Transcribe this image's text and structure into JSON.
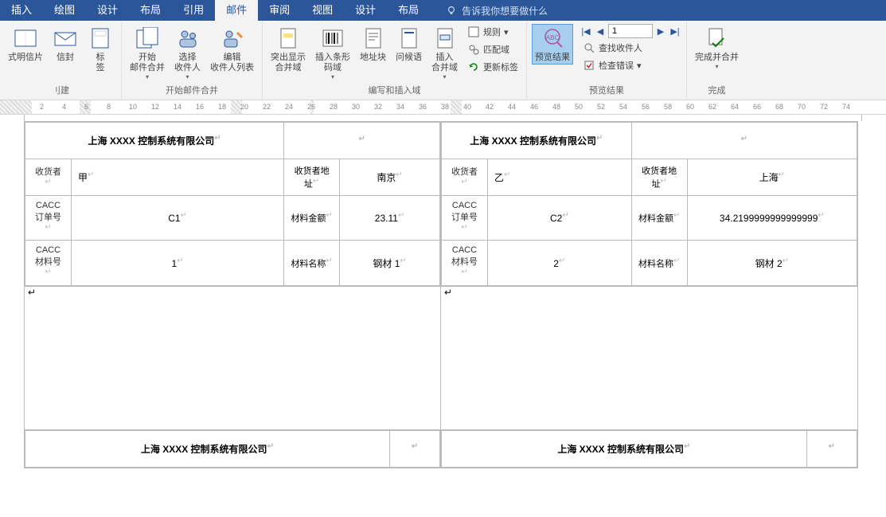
{
  "menubar": {
    "tabs": [
      "插入",
      "绘图",
      "设计",
      "布局",
      "引用",
      "邮件",
      "审阅",
      "视图",
      "设计",
      "布局"
    ],
    "active_index": 5,
    "tell_me_placeholder": "告诉我你想要做什么"
  },
  "ribbon": {
    "group_create": {
      "label": "刂建",
      "buttons": {
        "postcard": "式明信片",
        "envelope": "信封",
        "label": "标\n签"
      }
    },
    "group_start": {
      "label": "开始邮件合并",
      "buttons": {
        "start_merge": "开始\n邮件合并",
        "select_recip": "选择\n收件人",
        "edit_recip": "编辑\n收件人列表"
      }
    },
    "group_write": {
      "label": "编写和插入域",
      "buttons": {
        "highlight": "突出显示\n合并域",
        "barcode": "插入条形\n码域",
        "address": "地址块",
        "greeting": "问候语",
        "merge_field": "插入\n合并域"
      },
      "small": {
        "rules": "规则",
        "match": "匹配域",
        "update": "更新标签"
      }
    },
    "group_preview": {
      "label": "预览结果",
      "buttons": {
        "preview": "预览结果"
      },
      "nav_value": "1",
      "small": {
        "find": "查找收件人",
        "check": "检查错误"
      }
    },
    "group_finish": {
      "label": "完成",
      "buttons": {
        "finish": "完成并合并"
      }
    }
  },
  "ruler": {
    "ticks": [
      2,
      4,
      6,
      8,
      10,
      12,
      14,
      16,
      18,
      20,
      22,
      24,
      26,
      28,
      30,
      32,
      34,
      36,
      38,
      40,
      42,
      44,
      46,
      48,
      50,
      52,
      54,
      56,
      58,
      60,
      62,
      64,
      66,
      68,
      70,
      72,
      74
    ]
  },
  "document": {
    "title": "上海 XXXX 控制系统有限公司",
    "labels_row1": [
      {
        "recv_lbl": "收货者",
        "recv": "甲",
        "addr_lbl": "收货者地址",
        "addr": "南京",
        "order_lbl": "CACC\n订单号",
        "order": "C1",
        "amt_lbl": "材料金额",
        "amt": "23.11",
        "mat_lbl": "CACC\n材料号",
        "mat": "1",
        "name_lbl": "材料名称",
        "name": "钢材 1"
      },
      {
        "recv_lbl": "收货者",
        "recv": "乙",
        "addr_lbl": "收货者地址",
        "addr": "上海",
        "order_lbl": "CACC\n订单号",
        "order": "C2",
        "amt_lbl": "材料金额",
        "amt": "34.2199999999999999",
        "mat_lbl": "CACC\n材料号",
        "mat": "2",
        "name_lbl": "材料名称",
        "name": "钢材 2"
      }
    ],
    "labels_row2_title": "上海 XXXX 控制系统有限公司"
  }
}
